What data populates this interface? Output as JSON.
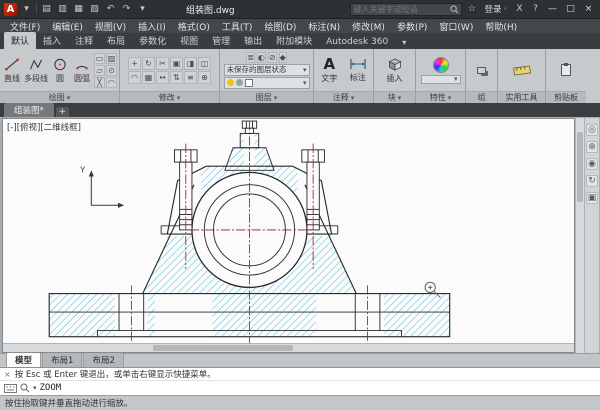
{
  "icons": {
    "dropdown": "▾",
    "close": "×",
    "minimize": "—",
    "maximize": "□",
    "help": "?",
    "favorite": "☆",
    "exchange": "X"
  },
  "titlebar": {
    "logo_letter": "A",
    "title": "组装图.dwg",
    "search_placeholder": "键入关键字或短语",
    "signin_label": "登录",
    "qat": [
      {
        "name": "new",
        "glyph": "▤"
      },
      {
        "name": "open",
        "glyph": "▥"
      },
      {
        "name": "save",
        "glyph": "▦"
      },
      {
        "name": "plot",
        "glyph": "▧"
      },
      {
        "name": "undo",
        "glyph": "↶"
      },
      {
        "name": "redo",
        "glyph": "↷"
      }
    ]
  },
  "menubar": {
    "items": [
      "文件(F)",
      "编辑(E)",
      "视图(V)",
      "插入(I)",
      "格式(O)",
      "工具(T)",
      "绘图(D)",
      "标注(N)",
      "修改(M)",
      "参数(P)",
      "窗口(W)",
      "帮助(H)"
    ]
  },
  "ribbon": {
    "tabs": [
      "默认",
      "插入",
      "注释",
      "布局",
      "参数化",
      "视图",
      "管理",
      "输出",
      "附加模块",
      "Autodesk 360"
    ],
    "active_tab": "默认",
    "draw_panel": {
      "title": "绘图",
      "tools": [
        "直线",
        "多段线",
        "圆",
        "圆弧"
      ],
      "extra_glyphs": [
        "▭",
        "▨",
        "▱",
        "⊙",
        "╳",
        "◠"
      ]
    },
    "modify_panel": {
      "title": "修改",
      "glyphs": [
        "+",
        "↻",
        "✂",
        "▣",
        "◨",
        "◫",
        "◠",
        "▦",
        "↔",
        "⇅",
        "≡",
        "⊕"
      ]
    },
    "layer_panel": {
      "title": "图层",
      "state_label": "未保存的图层状态",
      "top_glyphs": [
        "≣",
        "◐",
        "⊘",
        "◆"
      ]
    },
    "annotate_panel": {
      "title": "注释",
      "text_glyph": "A",
      "text_label": "文字",
      "dim_label": "标注"
    },
    "block_panel": {
      "title": "块",
      "insert_label": "插入"
    },
    "properties_panel": {
      "title": "特性"
    },
    "group_panel": {
      "title": "组"
    },
    "utility_panel": {
      "title": "实用工具"
    },
    "clipboard_panel": {
      "title": "剪贴板"
    }
  },
  "filetabs": {
    "drawing_tab": "组装图*",
    "new_tab_glyph": "+"
  },
  "canvas": {
    "viewport_label": "[-][俯视][二维线框]",
    "ucs_y_label": "Y",
    "nav_glyphs": [
      "◎",
      "⊕",
      "◉",
      "↻",
      "▣"
    ]
  },
  "layout_tabs": {
    "items": [
      "模型",
      "布局1",
      "布局2"
    ],
    "active": "模型"
  },
  "command": {
    "history_line": "按 Esc 或 Enter 键退出，或单击右键显示快捷菜单。",
    "active_command": "ZOOM"
  },
  "statusbar": {
    "hint": "按住抬取键并垂直拖动进行缩放。"
  },
  "colors": {
    "hatch_cyan": "#00a8cc",
    "centerline_red": "#d40000",
    "accent_red": "#c8331b"
  }
}
